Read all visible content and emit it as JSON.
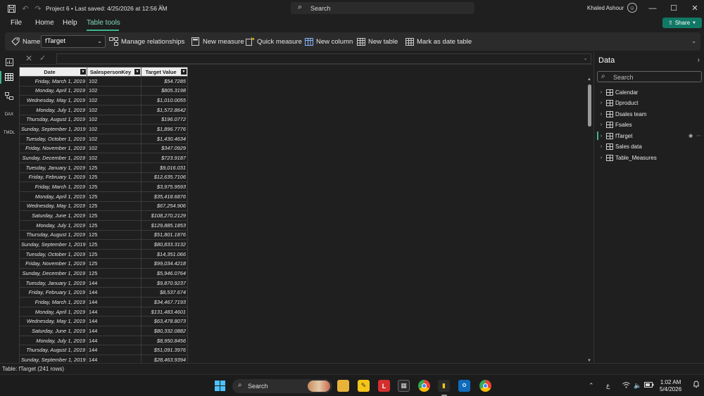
{
  "titlebar": {
    "title": "Project 6 • Last saved: 4/25/2026 at 12:56 AM",
    "search_placeholder": "Search",
    "user_name": "Khaled Ashour"
  },
  "menu": {
    "items": [
      "File",
      "Home",
      "Help",
      "Table tools"
    ],
    "active": "Table tools",
    "share_label": "Share"
  },
  "ribbon": {
    "name_label": "Name",
    "name_value": "fTarget",
    "buttons": [
      "Manage relationships",
      "New measure",
      "Quick measure",
      "New column",
      "New table",
      "Mark as date table"
    ]
  },
  "table": {
    "columns": [
      "Date",
      "SalespersonKey",
      "Target Value"
    ],
    "rows": [
      [
        "Friday, March 1, 2019",
        "102",
        "$54.7285"
      ],
      [
        "Monday, April 1, 2019",
        "102",
        "$805.3198"
      ],
      [
        "Wednesday, May 1, 2019",
        "102",
        "$1,010.0055"
      ],
      [
        "Monday, July 1, 2019",
        "102",
        "$1,572.8642"
      ],
      [
        "Thursday, August 1, 2019",
        "102",
        "$196.0772"
      ],
      [
        "Sunday, September 1, 2019",
        "102",
        "$1,896.7776"
      ],
      [
        "Tuesday, October 1, 2019",
        "102",
        "$1,430.4634"
      ],
      [
        "Friday, November 1, 2019",
        "102",
        "$347.0929"
      ],
      [
        "Sunday, December 1, 2019",
        "102",
        "$723.9187"
      ],
      [
        "Tuesday, January 1, 2019",
        "125",
        "$9,016.031"
      ],
      [
        "Friday, February 1, 2019",
        "125",
        "$12,635.7106"
      ],
      [
        "Friday, March 1, 2019",
        "125",
        "$3,975.9593"
      ],
      [
        "Monday, April 1, 2019",
        "125",
        "$35,418.6876"
      ],
      [
        "Wednesday, May 1, 2019",
        "125",
        "$67,254.906"
      ],
      [
        "Saturday, June 1, 2019",
        "125",
        "$108,270.2129"
      ],
      [
        "Monday, July 1, 2019",
        "125",
        "$129,885.1853"
      ],
      [
        "Thursday, August 1, 2019",
        "125",
        "$51,801.1876"
      ],
      [
        "Sunday, September 1, 2019",
        "125",
        "$80,833.3132"
      ],
      [
        "Tuesday, October 1, 2019",
        "125",
        "$14,351.066"
      ],
      [
        "Friday, November 1, 2019",
        "125",
        "$99,034.4218"
      ],
      [
        "Sunday, December 1, 2019",
        "125",
        "$5,946.0764"
      ],
      [
        "Tuesday, January 1, 2019",
        "144",
        "$9,870.9237"
      ],
      [
        "Friday, February 1, 2019",
        "144",
        "$8,537.674"
      ],
      [
        "Friday, March 1, 2019",
        "144",
        "$34,467.7193"
      ],
      [
        "Monday, April 1, 2019",
        "144",
        "$131,483.4601"
      ],
      [
        "Wednesday, May 1, 2019",
        "144",
        "$63,478.8073"
      ],
      [
        "Saturday, June 1, 2019",
        "144",
        "$80,332.0882"
      ],
      [
        "Monday, July 1, 2019",
        "144",
        "$8,950.8456"
      ],
      [
        "Thursday, August 1, 2019",
        "144",
        "$51,091.3976"
      ],
      [
        "Sunday, September 1, 2019",
        "144",
        "$28,463.9394"
      ]
    ]
  },
  "data_pane": {
    "title": "Data",
    "search_placeholder": "Search",
    "tables": [
      "Calendar",
      "Dproduct",
      "Dsales team",
      "Fsales",
      "fTarget",
      "Sales data",
      "Table_Measures"
    ],
    "selected": "fTarget"
  },
  "status": {
    "text": "Table: fTarget (241 rows)"
  },
  "taskbar": {
    "search_label": "Search",
    "time": "1:02 AM",
    "date": "5/4/2026",
    "lang": "ع"
  },
  "colors": {
    "accent": "#3eb489",
    "share": "#117865",
    "header_bg": "#ededed"
  }
}
